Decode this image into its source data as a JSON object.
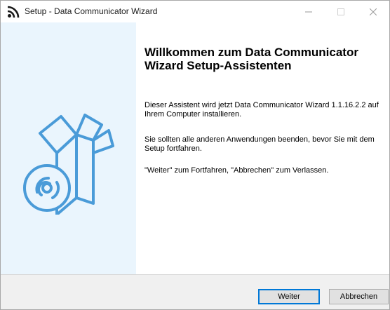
{
  "window": {
    "title": "Setup - Data Communicator Wizard",
    "icons": {
      "app": "rss-feed-icon",
      "minimize": "minimize-icon",
      "maximize": "maximize-icon",
      "close": "close-icon"
    }
  },
  "content": {
    "heading": "Willkommen zum Data Communicator Wizard Setup-Assistenten",
    "paragraph_1": "Dieser Assistent wird jetzt Data Communicator Wizard 1.1.16.2.2 auf Ihrem Computer installieren.",
    "paragraph_2": "Sie sollten alle anderen Anwendungen beenden, bevor Sie mit dem Setup fortfahren.",
    "paragraph_3": "\"Weiter\" zum Fortfahren, \"Abbrechen\" zum Verlassen."
  },
  "sidebar": {
    "illustration": "setup-box-disc-icon",
    "background": "#eaf5fd",
    "accent": "#4a9bd8"
  },
  "buttons": {
    "next_label": "Weiter",
    "cancel_label": "Abbrechen"
  }
}
